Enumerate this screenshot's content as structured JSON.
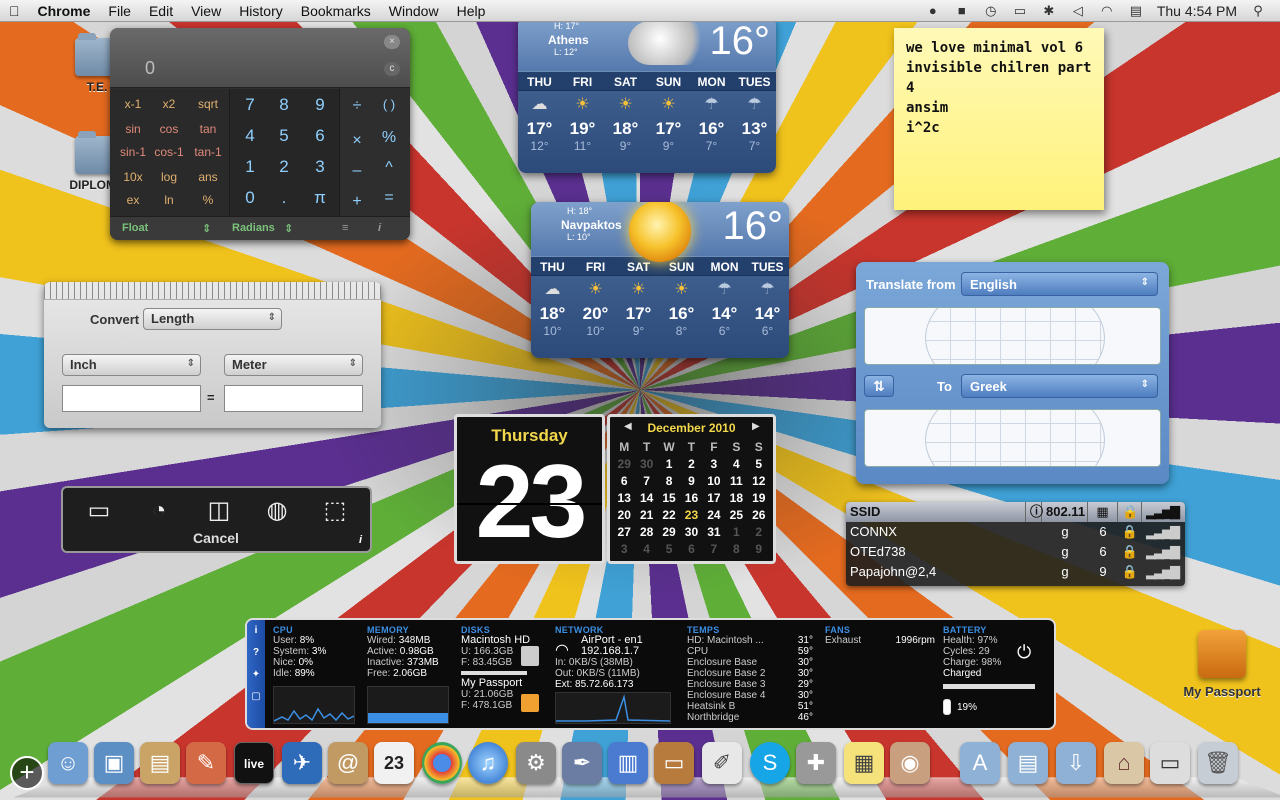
{
  "menubar": {
    "apple": "",
    "app": "Chrome",
    "items": [
      "File",
      "Edit",
      "View",
      "History",
      "Bookmarks",
      "Window",
      "Help"
    ],
    "clock": "Thu 4:54 PM"
  },
  "desktop": {
    "icons": [
      "T.E.",
      "DIPLOMA"
    ],
    "passport": "My Passport"
  },
  "calculator": {
    "display": "0",
    "sci": [
      [
        "x-1",
        "x2",
        "sqrt"
      ],
      [
        "sin",
        "cos",
        "tan"
      ],
      [
        "sin-1",
        "cos-1",
        "tan-1"
      ],
      [
        "10x",
        "log",
        "ans"
      ],
      [
        "ex",
        "ln",
        "%"
      ]
    ],
    "nums": [
      [
        "7",
        "8",
        "9"
      ],
      [
        "4",
        "5",
        "6"
      ],
      [
        "1",
        "2",
        "3"
      ],
      [
        "0",
        ".",
        "π"
      ]
    ],
    "ops": [
      [
        "÷",
        "( )"
      ],
      [
        "×",
        "%"
      ],
      [
        "–",
        "^"
      ],
      [
        "+",
        "="
      ]
    ],
    "mode1": "Float",
    "mode2": "Radians"
  },
  "weather1": {
    "city": "Athens",
    "hi": "H: 17°",
    "lo": "L: 12°",
    "temp": "16°",
    "days": [
      "THU",
      "FRI",
      "SAT",
      "SUN",
      "MON",
      "TUES"
    ],
    "icons": [
      "☁",
      "☀",
      "☀",
      "☀",
      "☂",
      "☂"
    ],
    "highs": [
      "17°",
      "19°",
      "18°",
      "17°",
      "16°",
      "13°"
    ],
    "lows": [
      "12°",
      "11°",
      "9°",
      "9°",
      "7°",
      "7°"
    ]
  },
  "weather2": {
    "city": "Navpaktos",
    "hi": "H: 18°",
    "lo": "L: 10°",
    "temp": "16°",
    "days": [
      "THU",
      "FRI",
      "SAT",
      "SUN",
      "MON",
      "TUES"
    ],
    "icons": [
      "☁",
      "☀",
      "☀",
      "☀",
      "☂",
      "☂"
    ],
    "highs": [
      "18°",
      "20°",
      "17°",
      "16°",
      "14°",
      "14°"
    ],
    "lows": [
      "10°",
      "10°",
      "9°",
      "8°",
      "6°",
      "6°"
    ]
  },
  "sticky": {
    "lines": [
      "we love minimal vol 6",
      "invisible chilren part 4",
      "ansim",
      "i^2c"
    ]
  },
  "converter": {
    "label": "Convert",
    "type": "Length",
    "from": "Inch",
    "to": "Meter",
    "from_value": "",
    "to_value": "",
    "eq": "="
  },
  "flip": {
    "day": "Thursday",
    "date": "23"
  },
  "calendar": {
    "month": "December 2010",
    "dow": [
      "M",
      "T",
      "W",
      "T",
      "F",
      "S",
      "S"
    ],
    "weeks": [
      [
        "29",
        "30",
        "1",
        "2",
        "3",
        "4",
        "5"
      ],
      [
        "6",
        "7",
        "8",
        "9",
        "10",
        "11",
        "12"
      ],
      [
        "13",
        "14",
        "15",
        "16",
        "17",
        "18",
        "19"
      ],
      [
        "20",
        "21",
        "22",
        "23",
        "24",
        "25",
        "26"
      ],
      [
        "27",
        "28",
        "29",
        "30",
        "31",
        "1",
        "2"
      ],
      [
        "3",
        "4",
        "5",
        "6",
        "7",
        "8",
        "9"
      ]
    ]
  },
  "translate": {
    "from_label": "Translate from",
    "from": "English",
    "to_label": "To",
    "to": "Greek",
    "swap": "⇅"
  },
  "wifi": {
    "headers": [
      "SSID",
      "802.11"
    ],
    "rows": [
      [
        "CONNX",
        "g",
        "6"
      ],
      [
        "OTEd738",
        "g",
        "6"
      ],
      [
        "Papajohn@2,4",
        "g",
        "9"
      ]
    ]
  },
  "istat": {
    "cpu": {
      "title": "CPU",
      "rows": [
        [
          "User:",
          "8%"
        ],
        [
          "System:",
          "3%"
        ],
        [
          "Nice:",
          "0%"
        ],
        [
          "Idle:",
          "89%"
        ]
      ]
    },
    "memory": {
      "title": "MEMORY",
      "rows": [
        [
          "Wired:",
          "348MB"
        ],
        [
          "Active:",
          "0.98GB"
        ],
        [
          "Inactive:",
          "373MB"
        ],
        [
          "Free:",
          "2.06GB"
        ]
      ]
    },
    "disks": {
      "title": "DISKS",
      "d1": "Macintosh HD",
      "d1u": "U: 166.3GB",
      "d1f": "F: 83.45GB",
      "d2": "My Passport",
      "d2u": "U: 21.06GB",
      "d2f": "F: 478.1GB"
    },
    "network": {
      "title": "NETWORK",
      "iface": "AirPort - en1",
      "ip": "192.168.1.7",
      "in": "In: 0KB/S (38MB)",
      "out": "Out: 0KB/S (11MB)",
      "ext": "Ext: 85.72.66.173"
    },
    "temps": {
      "title": "TEMPS",
      "rows": [
        [
          "HD: Macintosh ...",
          "31°"
        ],
        [
          "CPU",
          "59°"
        ],
        [
          "Enclosure Base",
          "30°"
        ],
        [
          "Enclosure Base 2",
          "30°"
        ],
        [
          "Enclosure Base 3",
          "29°"
        ],
        [
          "Enclosure Base 4",
          "30°"
        ],
        [
          "Heatsink B",
          "51°"
        ],
        [
          "Northbridge",
          "46°"
        ]
      ]
    },
    "fans": {
      "title": "FANS",
      "name": "Exhaust",
      "rpm": "1996rpm"
    },
    "battery": {
      "title": "BATTERY",
      "health": "Health: 97%",
      "cycles": "Cycles: 29",
      "charge": "Charge: 98%",
      "status": "Charged",
      "pct": "19%"
    }
  },
  "shot": {
    "cancel": "Cancel",
    "info": "i"
  },
  "dock": {
    "live": "live",
    "calendar_day": "23"
  }
}
